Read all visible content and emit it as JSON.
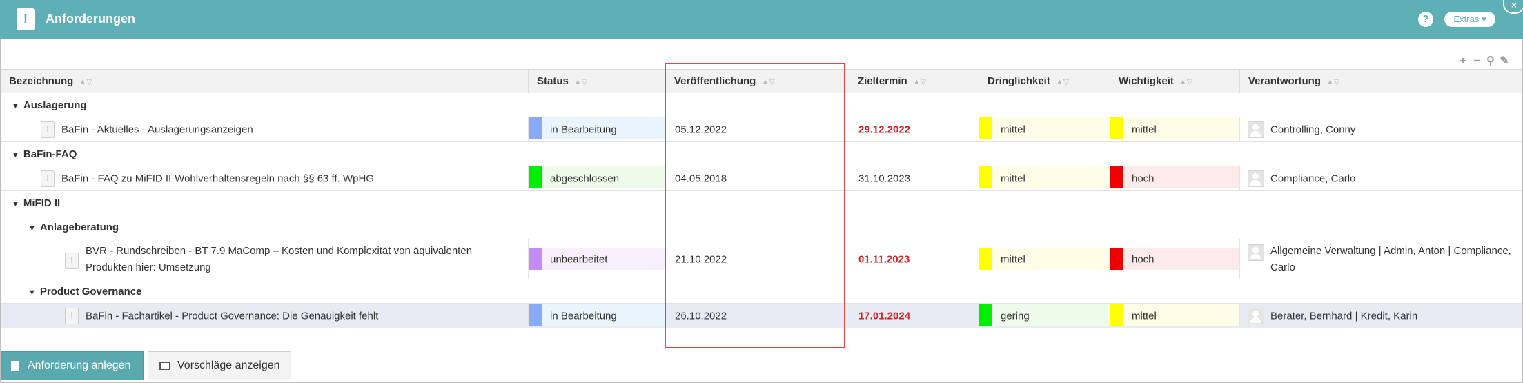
{
  "header": {
    "title": "Anforderungen",
    "app_icon": "!",
    "help_label": "?",
    "extras_label": "Extras",
    "close_label": "×"
  },
  "toolbar_icons": [
    "plus-icon",
    "minus-icon",
    "search-icon",
    "wrench-icon"
  ],
  "columns": [
    "Bezeichnung",
    "Status",
    "Veröffentlichung",
    "Zieltermin",
    "Dringlichkeit",
    "Wichtigkeit",
    "Verantwortung"
  ],
  "sort_indicator": "▲▽",
  "groups": {
    "auslagerung": "Auslagerung",
    "bafin_faq": "BaFin-FAQ",
    "mifid": "MiFID II",
    "anlageberatung": "Anlageberatung",
    "product_governance": "Product Governance"
  },
  "rows": [
    {
      "name": "BaFin - Aktuelles - Auslagerungsanzeigen",
      "status": "in Bearbeitung",
      "status_color": "#8aa9f7",
      "status_tint": "#eaf4fd",
      "published": "05.12.2022",
      "target": "29.12.2022",
      "target_overdue": true,
      "urgency": "mittel",
      "urgency_color": "#ffff00",
      "urgency_tint": "#fdfde8",
      "importance": "mittel",
      "importance_color": "#ffff00",
      "importance_tint": "#fdfde8",
      "responsible": "Controlling, Conny"
    },
    {
      "name": "BaFin - FAQ zu MiFID II-Wohlverhaltensregeln nach §§ 63 ff. WpHG",
      "status": "abgeschlossen",
      "status_color": "#00ee00",
      "status_tint": "#eefaea",
      "published": "04.05.2018",
      "target": "31.10.2023",
      "target_overdue": false,
      "urgency": "mittel",
      "urgency_color": "#ffff00",
      "urgency_tint": "#fdfde8",
      "importance": "hoch",
      "importance_color": "#ee0000",
      "importance_tint": "#fdeaea",
      "responsible": "Compliance, Carlo"
    },
    {
      "name": "BVR - Rundschreiben - BT 7.9 MaComp – Kosten und Komplexität von äquivalenten Produkten hier: Umsetzung",
      "status": "unbearbeitet",
      "status_color": "#c48cf7",
      "status_tint": "#f8eefc",
      "published": "21.10.2022",
      "target": "01.11.2023",
      "target_overdue": true,
      "urgency": "mittel",
      "urgency_color": "#ffff00",
      "urgency_tint": "#fdfde8",
      "importance": "hoch",
      "importance_color": "#ee0000",
      "importance_tint": "#fdeaea",
      "responsible": "Allgemeine Verwaltung | Admin, Anton | Compliance, Carlo"
    },
    {
      "name": "BaFin - Fachartikel - Product Governance: Die Genauigkeit fehlt",
      "status": "in Bearbeitung",
      "status_color": "#8aa9f7",
      "status_tint": "#eaf4fd",
      "published": "26.10.2022",
      "target": "17.01.2024",
      "target_overdue": true,
      "urgency": "gering",
      "urgency_color": "#00ee00",
      "urgency_tint": "#eefaea",
      "importance": "mittel",
      "importance_color": "#ffff00",
      "importance_tint": "#fdfde8",
      "responsible": "Berater, Bernhard | Kredit, Karin"
    }
  ],
  "buttons": {
    "create": "Anforderung anlegen",
    "suggestions": "Vorschläge anzeigen"
  },
  "accent_color": "#5fb0b6"
}
